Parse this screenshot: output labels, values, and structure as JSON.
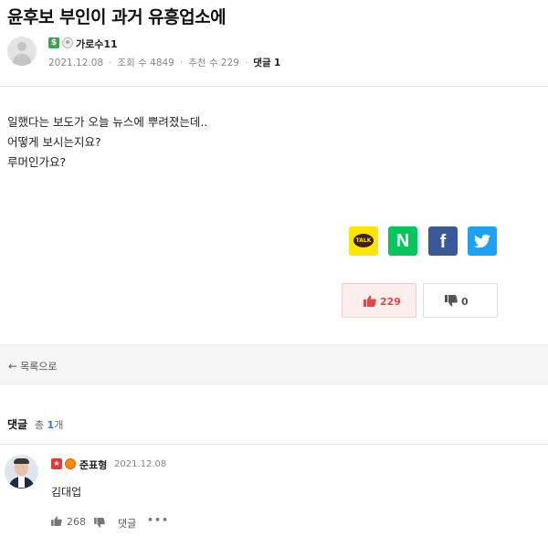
{
  "post": {
    "title": "윤후보 부인이 과거 유흥업소에",
    "author": "가로수11",
    "level_badge": "$",
    "date": "2021.12.08",
    "views_label": "조회 수",
    "views": "4849",
    "recommend_label": "추천 수",
    "recommend": "229",
    "comment_label": "댓글",
    "comment_count": "1",
    "body": [
      "일했다는 보도가 오늘 뉴스에 뿌려졌는데..",
      "어떻게 보시는지요?",
      "루머인가요?"
    ]
  },
  "share": {
    "kakao_label": "TALK",
    "naver_label": "N",
    "facebook_label": "f",
    "kakao_color": "#fee500",
    "naver_color": "#03c75a",
    "facebook_color": "#3b5998",
    "twitter_color": "#1da1f2"
  },
  "votes": {
    "up_count": "229",
    "down_count": "0"
  },
  "nav": {
    "back_label": "목록으로"
  },
  "comments": {
    "header_label": "댓글",
    "total_prefix": "총",
    "total_count": "1",
    "total_suffix": "개",
    "items": [
      {
        "author": "준표형",
        "date": "2021.12.08",
        "text": "김대업",
        "likes": "268",
        "reply_label": "댓글",
        "more_label": "•••"
      }
    ]
  }
}
